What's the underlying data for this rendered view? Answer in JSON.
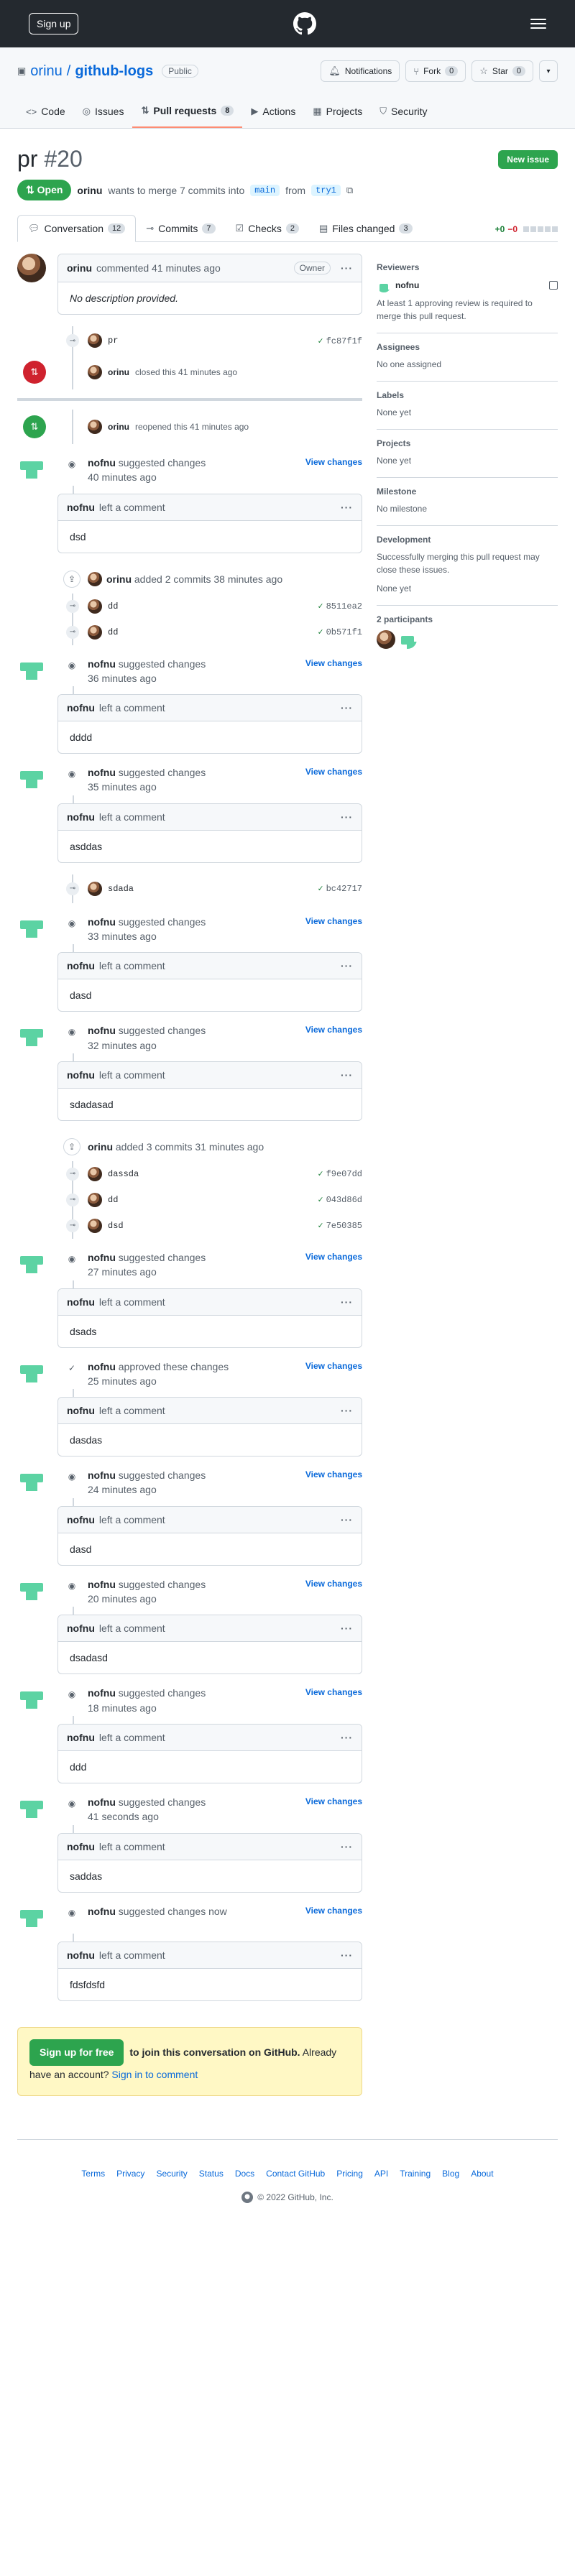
{
  "topbar": {
    "signup_label": "Sign up"
  },
  "repo": {
    "owner": "orinu",
    "sep": "/",
    "name": "github-logs",
    "visibility": "Public",
    "notifications_label": "Notifications",
    "fork_label": "Fork",
    "fork_count": "0",
    "star_label": "Star",
    "star_count": "0"
  },
  "repo_tabs": [
    {
      "label": "Code",
      "icon": "code-icon"
    },
    {
      "label": "Issues",
      "icon": "issue-icon"
    },
    {
      "label": "Pull requests",
      "icon": "pull-request-icon",
      "count": "8"
    },
    {
      "label": "Actions",
      "icon": "play-icon"
    },
    {
      "label": "Projects",
      "icon": "table-icon"
    },
    {
      "label": "Security",
      "icon": "shield-icon"
    }
  ],
  "pr": {
    "title": "pr",
    "number": "#20",
    "state": "Open",
    "new_issue_label": "New issue",
    "author": "orinu",
    "meta_text": "wants to merge 7 commits into",
    "base": "main",
    "from": "from",
    "head": "try1"
  },
  "pr_tabs": [
    {
      "label": "Conversation",
      "count": "12"
    },
    {
      "label": "Commits",
      "count": "7"
    },
    {
      "label": "Checks",
      "count": "2"
    },
    {
      "label": "Files changed",
      "count": "3"
    }
  ],
  "diffstat": {
    "add": "+0",
    "del": "−0"
  },
  "first_comment": {
    "author": "orinu",
    "action": "commented 41 minutes ago",
    "badge": "Owner",
    "body": "No description provided."
  },
  "first_commit": {
    "msg": "pr",
    "sha": "fc87f1f"
  },
  "closed_event": {
    "author": "orinu",
    "text": "closed this 41 minutes ago"
  },
  "reopened_event": {
    "author": "orinu",
    "text": "reopened this 41 minutes ago"
  },
  "review_common": {
    "view_changes": "View changes",
    "left_comment": "left a comment"
  },
  "reviews": [
    {
      "author": "nofnu",
      "action": "suggested changes",
      "time": "40 minutes ago",
      "body": "dsd"
    },
    {
      "author": "nofnu",
      "action": "suggested changes",
      "time": "36 minutes ago",
      "body": "dddd"
    },
    {
      "author": "nofnu",
      "action": "suggested changes",
      "time": "35 minutes ago",
      "body": "asddas"
    },
    {
      "author": "nofnu",
      "action": "suggested changes",
      "time": "33 minutes ago",
      "body": "dasd"
    },
    {
      "author": "nofnu",
      "action": "suggested changes",
      "time": "32 minutes ago",
      "body": "sdadasad"
    },
    {
      "author": "nofnu",
      "action": "suggested changes",
      "time": "27 minutes ago",
      "body": "dsads"
    },
    {
      "author": "nofnu",
      "action": "approved these changes",
      "time": "25 minutes ago",
      "body": "dasdas"
    },
    {
      "author": "nofnu",
      "action": "suggested changes",
      "time": "24 minutes ago",
      "body": "dasd"
    },
    {
      "author": "nofnu",
      "action": "suggested changes",
      "time": "20 minutes ago",
      "body": "dsadasd"
    },
    {
      "author": "nofnu",
      "action": "suggested changes",
      "time": "18 minutes ago",
      "body": "ddd"
    },
    {
      "author": "nofnu",
      "action": "suggested changes",
      "time": "41 seconds ago",
      "body": "saddas"
    },
    {
      "author": "nofnu",
      "action": "suggested changes now",
      "time": "",
      "body": "fdsfdsfd"
    }
  ],
  "push1": {
    "author": "orinu",
    "text": "added 2 commits 38 minutes ago",
    "commits": [
      {
        "msg": "dd",
        "sha": "8511ea2"
      },
      {
        "msg": "dd",
        "sha": "0b571f1"
      }
    ]
  },
  "single_commit": {
    "msg": "sdada",
    "sha": "bc42717"
  },
  "push2": {
    "author": "orinu",
    "text": "added 3 commits 31 minutes ago",
    "commits": [
      {
        "msg": "dassda",
        "sha": "f9e07dd"
      },
      {
        "msg": "dd",
        "sha": "043d86d"
      },
      {
        "msg": "dsd",
        "sha": "7e50385"
      }
    ]
  },
  "sidebar": {
    "reviewers_h": "Reviewers",
    "reviewer": "nofnu",
    "reviewers_note": "At least 1 approving review is required to merge this pull request.",
    "assignees_h": "Assignees",
    "assignees_v": "No one assigned",
    "labels_h": "Labels",
    "labels_v": "None yet",
    "projects_h": "Projects",
    "projects_v": "None yet",
    "milestone_h": "Milestone",
    "milestone_v": "No milestone",
    "development_h": "Development",
    "development_note": "Successfully merging this pull request may close these issues.",
    "development_v": "None yet",
    "participants_h": "2 participants"
  },
  "signup_box": {
    "button": "Sign up for free",
    "text1": "to join this conversation on GitHub.",
    "text2": "Already have an account?",
    "signin": "Sign in to comment"
  },
  "footer": {
    "links": [
      "Terms",
      "Privacy",
      "Security",
      "Status",
      "Docs",
      "Contact GitHub",
      "Pricing",
      "API",
      "Training",
      "Blog",
      "About"
    ],
    "copy": "© 2022 GitHub, Inc."
  }
}
